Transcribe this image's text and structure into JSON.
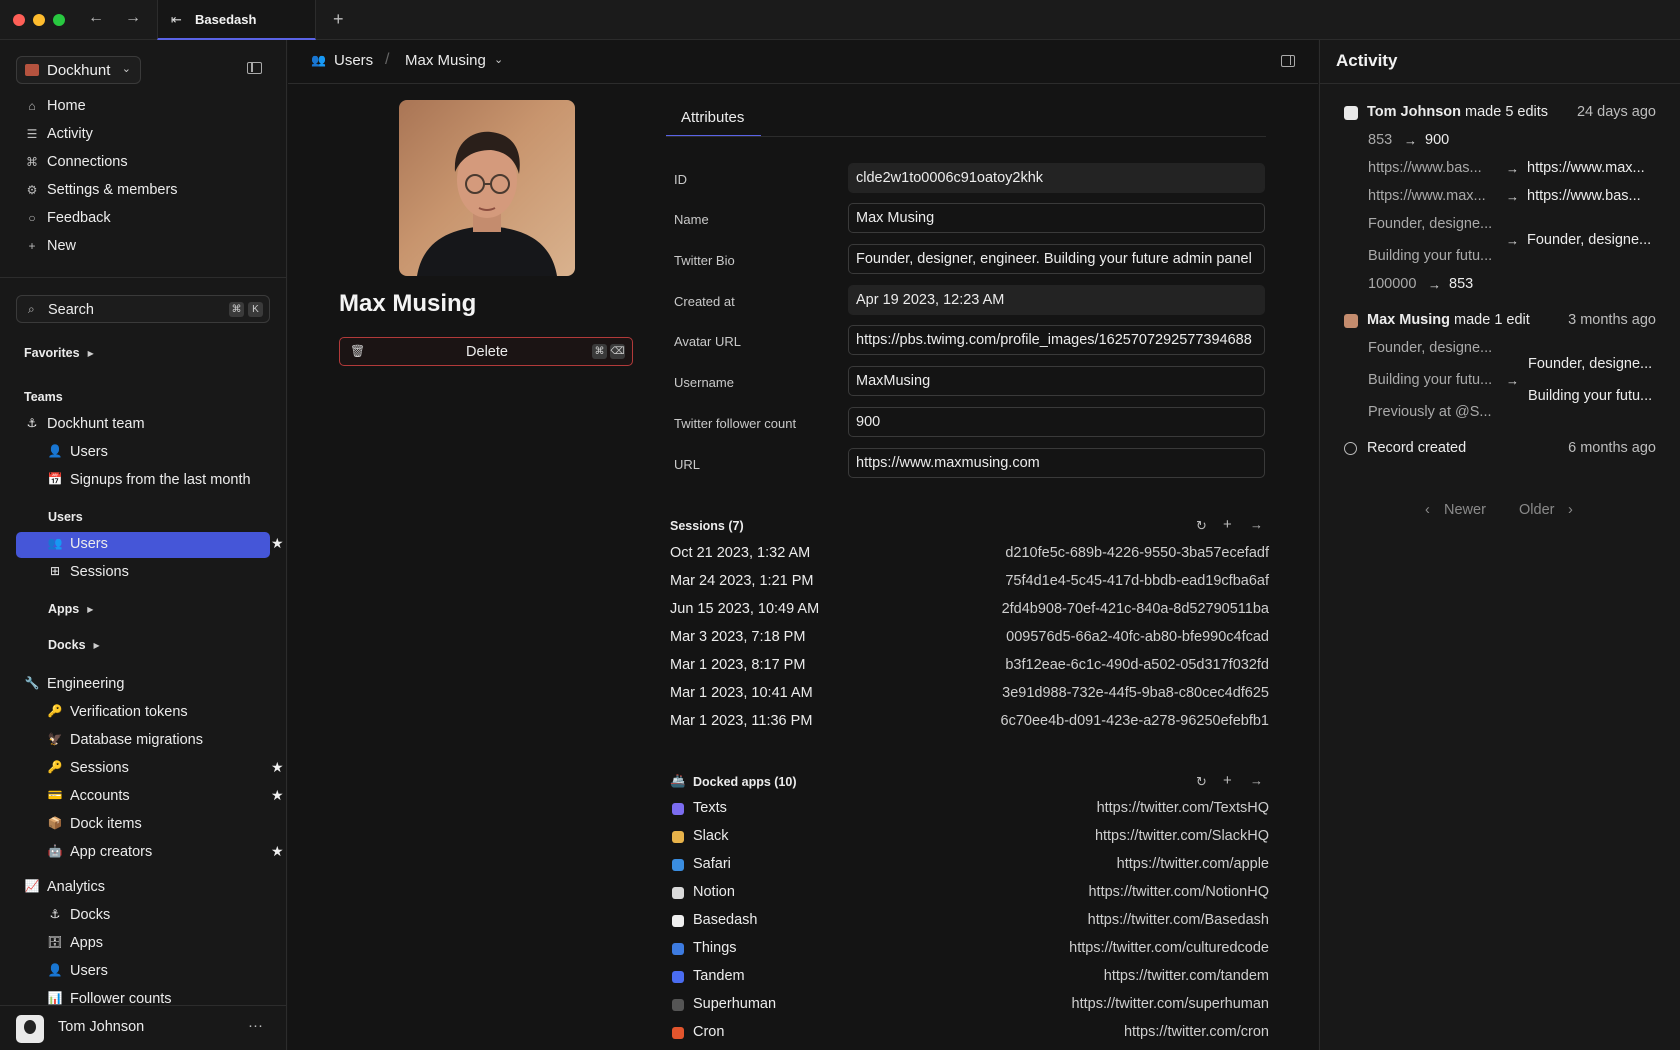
{
  "tab": {
    "label": "Basedash"
  },
  "sidebar": {
    "workspace": "Dockhunt",
    "nav": [
      {
        "label": "Home",
        "icon": "home-icon"
      },
      {
        "label": "Activity",
        "icon": "activity-icon"
      },
      {
        "label": "Connections",
        "icon": "connections-icon"
      },
      {
        "label": "Settings & members",
        "icon": "gear-icon"
      },
      {
        "label": "Feedback",
        "icon": "chat-bubble-icon"
      },
      {
        "label": "New",
        "icon": "plus-icon"
      }
    ],
    "search": {
      "label": "Search",
      "kbd1": "⌘",
      "kbd2": "K"
    },
    "favorites": "Favorites",
    "teams": "Teams",
    "dockhunt_team": "Dockhunt team",
    "dockhunt_children": [
      {
        "label": "Users",
        "emoji": "👤"
      },
      {
        "label": "Signups from the last month",
        "emoji": "📅"
      }
    ],
    "users_section": "Users",
    "users_children": [
      {
        "label": "Users",
        "emoji": "👥",
        "star": "★"
      },
      {
        "label": "Sessions",
        "emoji": "⊞"
      }
    ],
    "apps_section": "Apps",
    "docks_section": "Docks",
    "engineering": "Engineering",
    "engineering_children": [
      {
        "label": "Verification tokens",
        "emoji": "🔑"
      },
      {
        "label": "Database migrations",
        "emoji": "🦅"
      },
      {
        "label": "Sessions",
        "emoji": "🔑",
        "star": "★"
      },
      {
        "label": "Accounts",
        "emoji": "💳",
        "star": "★"
      },
      {
        "label": "Dock items",
        "emoji": "📦"
      },
      {
        "label": "App creators",
        "emoji": "🤖",
        "star": "★"
      }
    ],
    "analytics": "Analytics",
    "analytics_children": [
      {
        "label": "Docks",
        "emoji": "⚓"
      },
      {
        "label": "Apps",
        "emoji": "🗄"
      },
      {
        "label": "Users",
        "emoji": "👤"
      },
      {
        "label": "Follower counts",
        "emoji": "📊"
      }
    ],
    "user": "Tom Johnson"
  },
  "breadcrumb": {
    "table": "Users",
    "record": "Max Musing"
  },
  "record": {
    "title": "Max Musing",
    "delete_label": "Delete"
  },
  "attributes_tab": "Attributes",
  "attributes": [
    {
      "label": "ID",
      "value": "clde2w1to0006c91oatoy2khk",
      "readonly": true
    },
    {
      "label": "Name",
      "value": "Max Musing"
    },
    {
      "label": "Twitter Bio",
      "value": "Founder, designer, engineer. Building your future admin panel"
    },
    {
      "label": "Created at",
      "value": "Apr 19 2023, 12:23 AM",
      "readonly": true
    },
    {
      "label": "Avatar URL",
      "value": "https://pbs.twimg.com/profile_images/1625707292577394688"
    },
    {
      "label": "Username",
      "value": "MaxMusing"
    },
    {
      "label": "Twitter follower count",
      "value": "900"
    },
    {
      "label": "URL",
      "value": "https://www.maxmusing.com"
    }
  ],
  "sessions": {
    "title": "Sessions (7)",
    "rows": [
      {
        "date": "Oct 21 2023, 1:32 AM",
        "id": "d210fe5c-689b-4226-9550-3ba57ecefadf"
      },
      {
        "date": "Mar 24 2023, 1:21 PM",
        "id": "75f4d1e4-5c45-417d-bbdb-ead19cfba6af"
      },
      {
        "date": "Jun 15 2023, 10:49 AM",
        "id": "2fd4b908-70ef-421c-840a-8d52790511ba"
      },
      {
        "date": "Mar 3 2023, 7:18 PM",
        "id": "009576d5-66a2-40fc-ab80-bfe990c4fcad"
      },
      {
        "date": "Mar 1 2023, 8:17 PM",
        "id": "b3f12eae-6c1c-490d-a502-05d317f032fd"
      },
      {
        "date": "Mar 1 2023, 10:41 AM",
        "id": "3e91d988-732e-44f5-9ba8-c80cec4df625"
      },
      {
        "date": "Mar 1 2023, 11:36 PM",
        "id": "6c70ee4b-d091-423e-a278-96250efebfb1"
      }
    ]
  },
  "docked_apps": {
    "title": "Docked apps (10)",
    "rows": [
      {
        "name": "Texts",
        "url": "https://twitter.com/TextsHQ",
        "color": "#7b6cf0"
      },
      {
        "name": "Slack",
        "url": "https://twitter.com/SlackHQ",
        "color": "#e8b34a"
      },
      {
        "name": "Safari",
        "url": "https://twitter.com/apple",
        "color": "#3a8de0"
      },
      {
        "name": "Notion",
        "url": "https://twitter.com/NotionHQ",
        "color": "#d9d9d9"
      },
      {
        "name": "Basedash",
        "url": "https://twitter.com/Basedash",
        "color": "#f0f0f0"
      },
      {
        "name": "Things",
        "url": "https://twitter.com/culturedcode",
        "color": "#3d7be0"
      },
      {
        "name": "Tandem",
        "url": "https://twitter.com/tandem",
        "color": "#4a6cf0"
      },
      {
        "name": "Superhuman",
        "url": "https://twitter.com/superhuman",
        "color": "#555555"
      },
      {
        "name": "Cron",
        "url": "https://twitter.com/cron",
        "color": "#e2552d"
      }
    ]
  },
  "activity": {
    "title": "Activity",
    "events": [
      {
        "user": "Tom Johnson",
        "action": "made 5 edits",
        "time": "24 days ago"
      },
      {
        "user": "Max Musing",
        "action": "made 1 edit",
        "time": "3 months ago"
      },
      {
        "user": "",
        "action": "Record created",
        "time": "6 months ago"
      }
    ],
    "edits1": [
      {
        "old": "853",
        "new": "900"
      },
      {
        "old": "https://www.bas...",
        "new": "https://www.max..."
      },
      {
        "old": "https://www.max...",
        "new": "https://www.bas..."
      },
      {
        "old": "Founder, designe...",
        "old2": "Building your futu...",
        "new": "Founder, designe..."
      },
      {
        "old": "100000",
        "new": "853"
      }
    ],
    "edits2": {
      "old": [
        "Founder, designe...",
        "Building your futu...",
        "Previously at @S..."
      ],
      "new": [
        "Founder, designe...",
        "Building your futu..."
      ]
    },
    "newer": "Newer",
    "older": "Older"
  }
}
